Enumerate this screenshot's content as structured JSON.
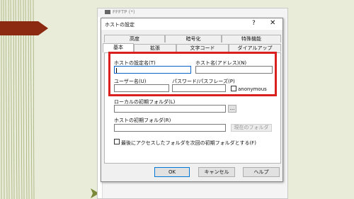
{
  "background_window": {
    "title": "FFFTP (*)"
  },
  "dialog": {
    "title": "ホストの設定",
    "help_label": "?",
    "close_label": "✕"
  },
  "tabs_row1": [
    "高度",
    "暗号化",
    "特殊機能"
  ],
  "tabs_row2": [
    "基本",
    "拡張",
    "文字コード",
    "ダイアルアップ"
  ],
  "active_tab": "基本",
  "form": {
    "host_setting_name_label": "ホストの設定名(T)",
    "host_setting_name_value": "",
    "host_name_label": "ホスト名(アドレス)(N)",
    "host_name_value": "",
    "username_label": "ユーザー名(U)",
    "username_value": "",
    "password_label": "パスワード/パスフレーズ(P)",
    "password_value": "",
    "anonymous_label": "anonymous",
    "anonymous_checked": false,
    "local_folder_label": "ローカルの初期フォルダ(L)",
    "local_folder_value": "",
    "browse_label": "...",
    "host_folder_label": "ホストの初期フォルダ(R)",
    "host_folder_value": "",
    "current_folder_label": "現在のフォルダ",
    "last_folder_label": "最後にアクセスしたフォルダを次回の初期フォルダとする(F)",
    "last_folder_checked": false
  },
  "buttons": {
    "ok": "OK",
    "cancel": "キャンセル",
    "help": "ヘルプ"
  },
  "colors": {
    "highlight": "#d9201e",
    "slide_bg": "#e9ecd8",
    "arrow": "#8b2a10"
  }
}
